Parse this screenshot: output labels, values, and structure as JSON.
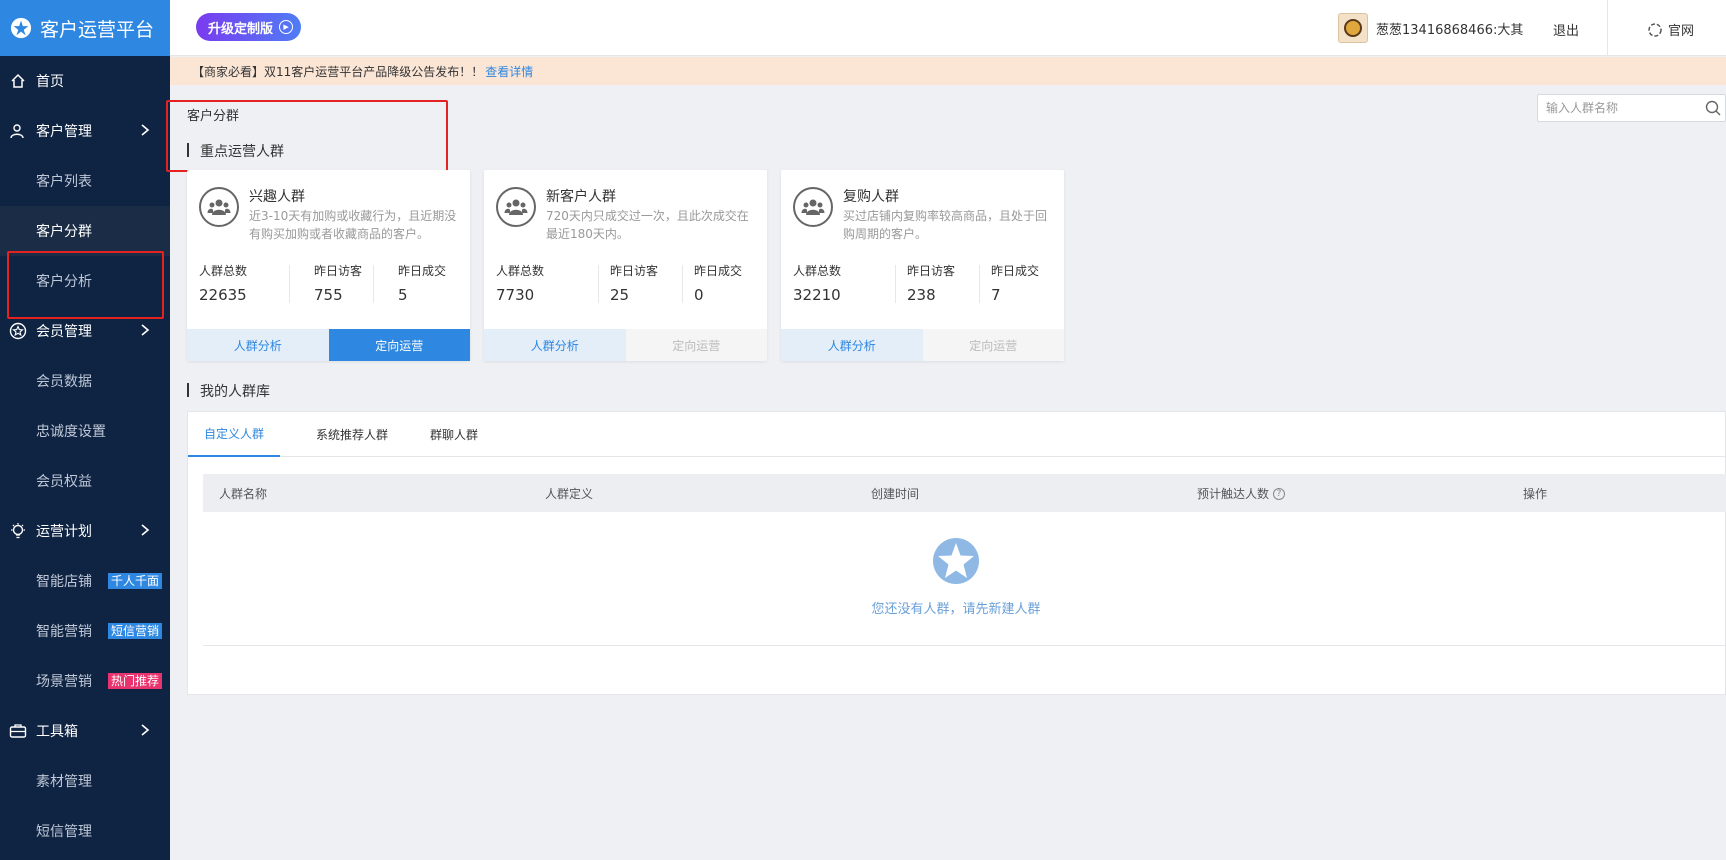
{
  "app": {
    "title": "客户运营平台",
    "upgrade_label": "升级定制版"
  },
  "header": {
    "user_name": "葱葱13416868466:大其",
    "logout_label": "退出",
    "official_label": "官网"
  },
  "notice": {
    "text": "【商家必看】双11客户运营平台产品降级公告发布！！",
    "link": "查看详情"
  },
  "sidebar": {
    "home": "首页",
    "customer_mgmt": "客户管理",
    "customer_list": "客户列表",
    "customer_segment": "客户分群",
    "customer_analysis": "客户分析",
    "member_mgmt": "会员管理",
    "member_data": "会员数据",
    "loyalty_settings": "忠诚度设置",
    "member_rights": "会员权益",
    "ops_plan": "运营计划",
    "smart_store": "智能店铺",
    "smart_store_tag": "千人千面",
    "smart_marketing": "智能营销",
    "smart_marketing_tag": "短信营销",
    "scene_marketing": "场景营销",
    "scene_marketing_tag": "热门推荐",
    "toolbox": "工具箱",
    "material_mgmt": "素材管理",
    "sms_mgmt": "短信管理"
  },
  "main": {
    "breadcrumb": "客户分群",
    "key_title": "重点运营人群",
    "search_placeholder": "输入人群名称",
    "cards": [
      {
        "title": "兴趣人群",
        "desc": "近3-10天有加购或收藏行为，且近期没有购买加购或者收藏商品的客户。",
        "stats": [
          {
            "label": "人群总数",
            "value": "22635"
          },
          {
            "label": "昨日访客",
            "value": "755"
          },
          {
            "label": "昨日成交",
            "value": "5"
          }
        ],
        "btn_left": "人群分析",
        "btn_right": "定向运营"
      },
      {
        "title": "新客户人群",
        "desc": "720天内只成交过一次，且此次成交在最近180天内。",
        "stats": [
          {
            "label": "人群总数",
            "value": "7730"
          },
          {
            "label": "昨日访客",
            "value": "25"
          },
          {
            "label": "昨日成交",
            "value": "0"
          }
        ],
        "btn_left": "人群分析",
        "btn_right": "定向运营"
      },
      {
        "title": "复购人群",
        "desc": "买过店铺内复购率较高商品，且处于回购周期的客户。",
        "stats": [
          {
            "label": "人群总数",
            "value": "32210"
          },
          {
            "label": "昨日访客",
            "value": "238"
          },
          {
            "label": "昨日成交",
            "value": "7"
          }
        ],
        "btn_left": "人群分析",
        "btn_right": "定向运营"
      }
    ],
    "library_title": "我的人群库",
    "tabs": [
      "自定义人群",
      "系统推荐人群",
      "群聊人群"
    ],
    "columns": [
      "人群名称",
      "人群定义",
      "创建时间",
      "预计触达人数",
      "操作"
    ],
    "empty_text": "您还没有人群，请先新建人群"
  },
  "colors": {
    "accent": "#2e87e0",
    "sidebar_bg": "#0f2343",
    "highlight_box": "#e52222"
  }
}
